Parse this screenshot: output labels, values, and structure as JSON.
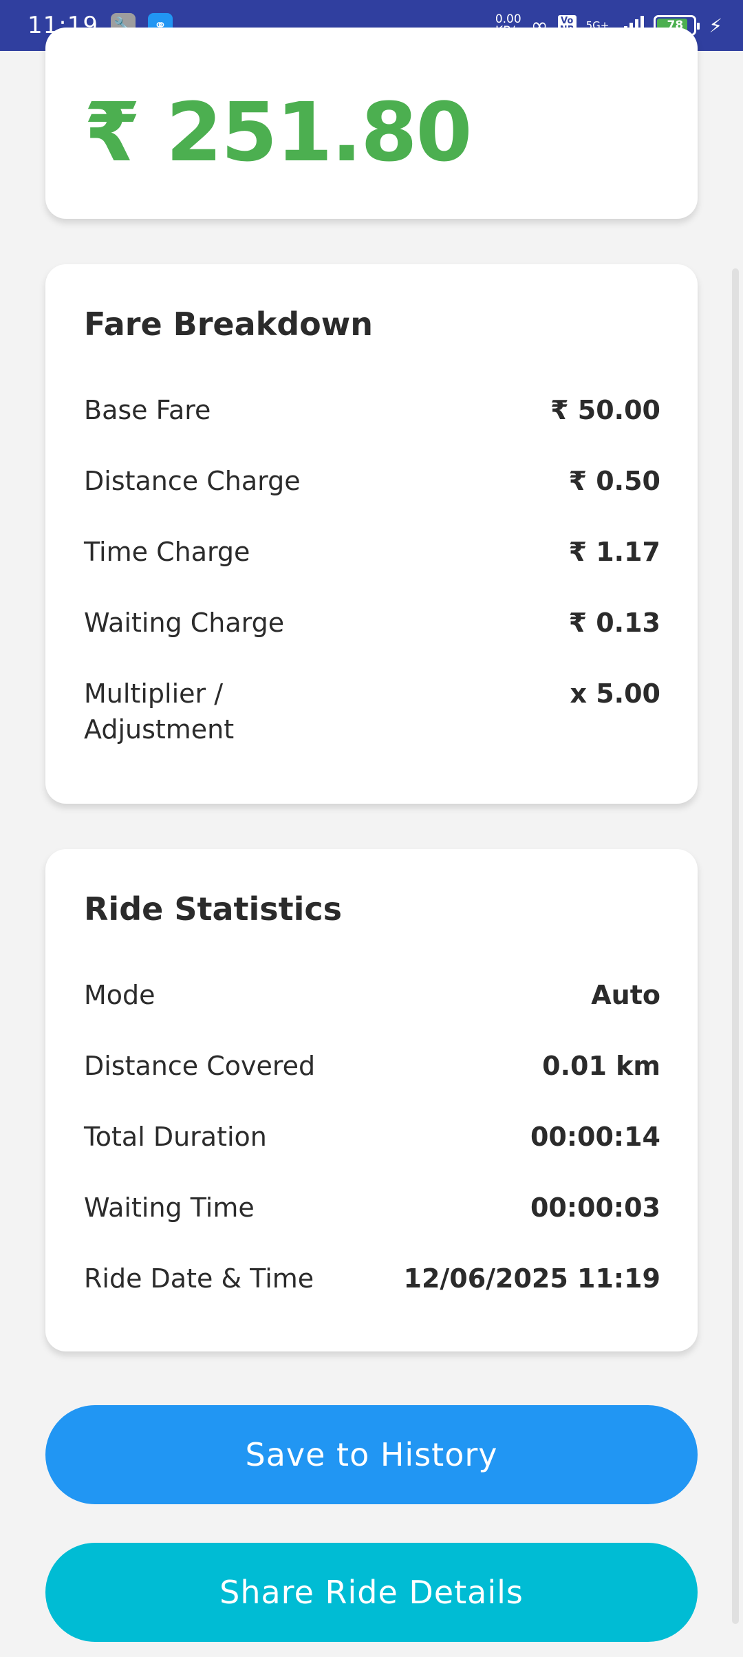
{
  "status_bar": {
    "time": "11:19",
    "network_speed": "0.00\nKB/s",
    "volte": "Vo\nNR",
    "network_type": "5G+",
    "battery_level": "78"
  },
  "fare": {
    "total": "₹ 251.80"
  },
  "breakdown": {
    "title": "Fare Breakdown",
    "rows": [
      {
        "label": "Base Fare",
        "value": "₹ 50.00"
      },
      {
        "label": "Distance Charge",
        "value": "₹ 0.50"
      },
      {
        "label": "Time Charge",
        "value": "₹ 1.17"
      },
      {
        "label": "Waiting Charge",
        "value": "₹ 0.13"
      },
      {
        "label": "Multiplier / Adjustment",
        "value": "x 5.00"
      }
    ]
  },
  "stats": {
    "title": "Ride Statistics",
    "rows": [
      {
        "label": "Mode",
        "value": "Auto"
      },
      {
        "label": "Distance Covered",
        "value": "0.01 km"
      },
      {
        "label": "Total Duration",
        "value": "00:00:14"
      },
      {
        "label": "Waiting Time",
        "value": "00:00:03"
      },
      {
        "label": "Ride Date & Time",
        "value": "12/06/2025 11:19"
      }
    ]
  },
  "actions": {
    "save_label": "Save to History",
    "share_label": "Share Ride Details"
  },
  "colors": {
    "status_bar": "#303f9f",
    "fare_amount": "#4caf50",
    "save_button": "#2196f3",
    "share_button": "#00bcd4"
  }
}
